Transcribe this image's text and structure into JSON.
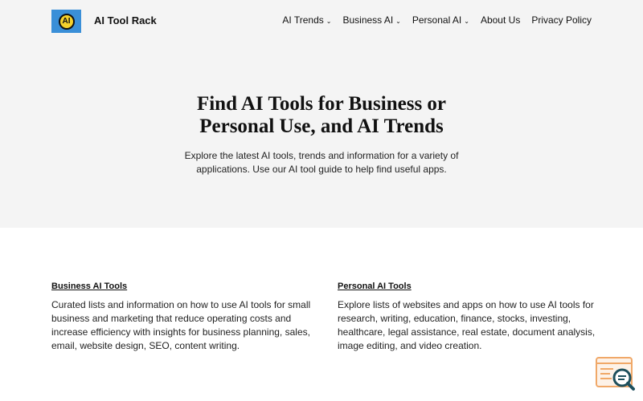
{
  "header": {
    "logo_text": "AI",
    "site_title": "AI Tool Rack",
    "nav": [
      {
        "label": "AI Trends",
        "has_dropdown": true
      },
      {
        "label": "Business AI",
        "has_dropdown": true
      },
      {
        "label": "Personal AI",
        "has_dropdown": true
      },
      {
        "label": "About Us",
        "has_dropdown": false
      },
      {
        "label": "Privacy Policy",
        "has_dropdown": false
      }
    ],
    "chevron": "⌄"
  },
  "hero": {
    "title_lines": [
      "Find AI Tools for Business or",
      "Personal Use, and AI Trends"
    ],
    "subtitle_lines": [
      "Explore the latest AI tools, trends and information for a variety of",
      "applications. Use our AI tool guide to help find useful apps."
    ]
  },
  "sections": {
    "business": {
      "heading": "Business AI Tools",
      "lines": [
        "Curated lists and information on how to use AI tools for small",
        "business and marketing that reduce operating costs and",
        "increase efficiency with insights for business planning, sales,",
        "email, website design, SEO, content writing."
      ]
    },
    "personal": {
      "heading": "Personal AI Tools",
      "lines": [
        "Explore lists of websites and apps on how to use AI tools for",
        "research, writing, education, finance, stocks, investing,",
        "healthcare, legal assistance, real estate, document analysis,",
        "image editing, and video creation."
      ]
    }
  },
  "colors": {
    "hero_background": "#f4f4f4",
    "logo_blue": "#3a8fd8",
    "logo_yellow": "#f5d12c",
    "widget_orange": "#f0a868",
    "widget_teal": "#1d4f5c"
  },
  "icons": {
    "widget": "search-widget-icon"
  }
}
